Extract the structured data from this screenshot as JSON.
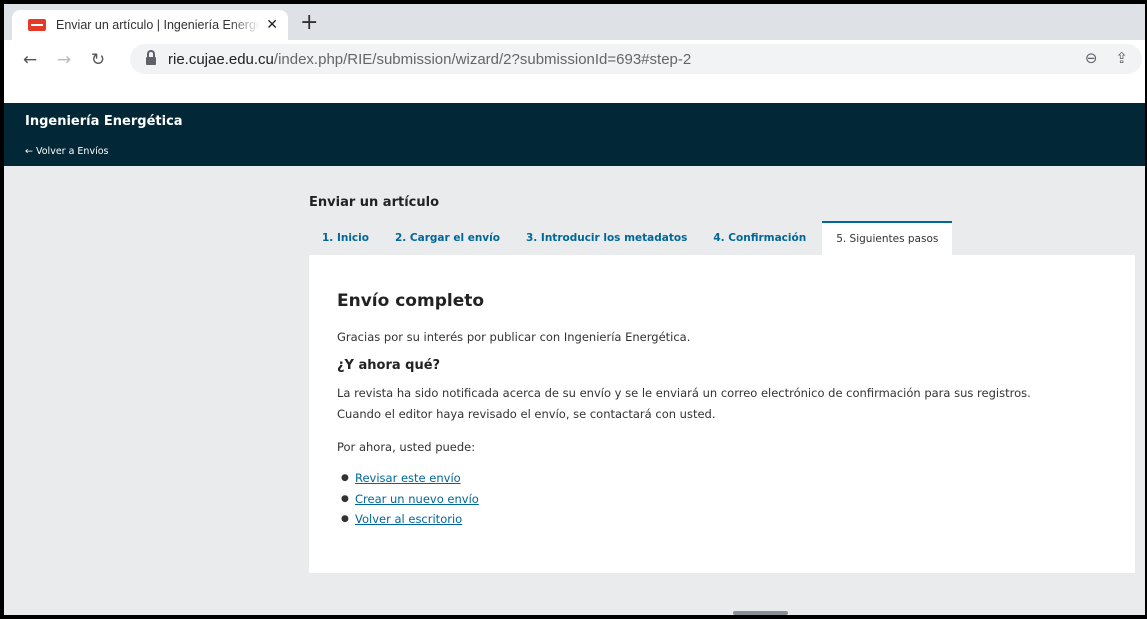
{
  "browser": {
    "tab": {
      "title": "Enviar un artículo | Ingeniería Energética",
      "close_glyph": "✕"
    },
    "new_tab_glyph": "+",
    "back_glyph": "←",
    "forward_glyph": "→",
    "reload_glyph": "↻",
    "url_host": "rie.cujae.edu.cu",
    "url_path": "/index.php/RIE/submission/wizard/2?submissionId=693#step-2",
    "zoom_glyph": "⊖",
    "share_glyph": "⇪",
    "icons": [
      "favicon-icon",
      "lock-icon",
      "zoom-icon",
      "share-icon"
    ]
  },
  "header": {
    "site_title": "Ingeniería Energética",
    "back_link": "← Volver a Envíos",
    "background": "#022838"
  },
  "main": {
    "heading": "Enviar un artículo",
    "tabs": [
      {
        "label": "1. Inicio"
      },
      {
        "label": "2. Cargar el envío"
      },
      {
        "label": "3. Introducir los metadatos"
      },
      {
        "label": "4. Confirmación"
      },
      {
        "label": "5. Siguientes pasos",
        "active": true
      }
    ],
    "content": {
      "title": "Envío completo",
      "thanks": "Gracias por su interés por publicar con Ingeniería Energética.",
      "subtitle": "¿Y ahora qué?",
      "notice_line1": "La revista ha sido notificada acerca de su envío y se le enviará un correo electrónico de confirmación para sus registros.",
      "notice_line2": "Cuando el editor haya revisado el envío, se contactará con usted.",
      "options_intro": "Por ahora, usted puede:",
      "links": [
        {
          "label": "Revisar este envío"
        },
        {
          "label": "Crear un nuevo envío"
        },
        {
          "label": "Volver al escritorio"
        }
      ]
    },
    "accent_color": "#006798"
  }
}
